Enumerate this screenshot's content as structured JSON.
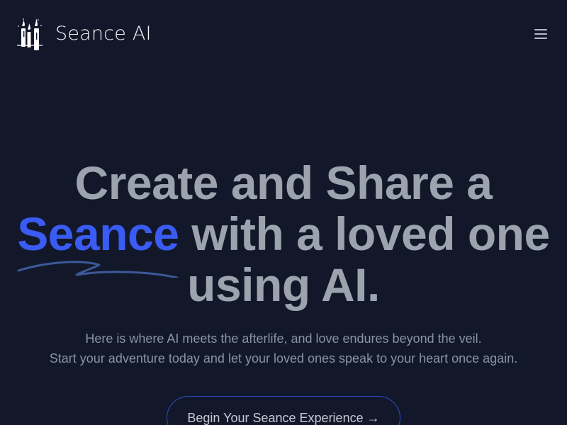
{
  "header": {
    "brand_name": "Seance AI",
    "logo_icon": "candles-icon",
    "menu_icon": "hamburger-menu-icon"
  },
  "hero": {
    "title_line1": "Create and Share a",
    "title_highlight": "Seance",
    "title_line2_rest": " with a loved one",
    "title_line3": "using AI.",
    "subtitle_line1": "Here is where AI meets the afterlife, and love endures beyond the veil.",
    "subtitle_line2": "Start your adventure today and let your loved ones speak to your heart once again.",
    "cta_label": "Begin Your Seance Experience →"
  },
  "colors": {
    "background": "#121829",
    "accent": "#3b5bf5",
    "heading": "#9ca3af",
    "text": "#8b93a3"
  }
}
